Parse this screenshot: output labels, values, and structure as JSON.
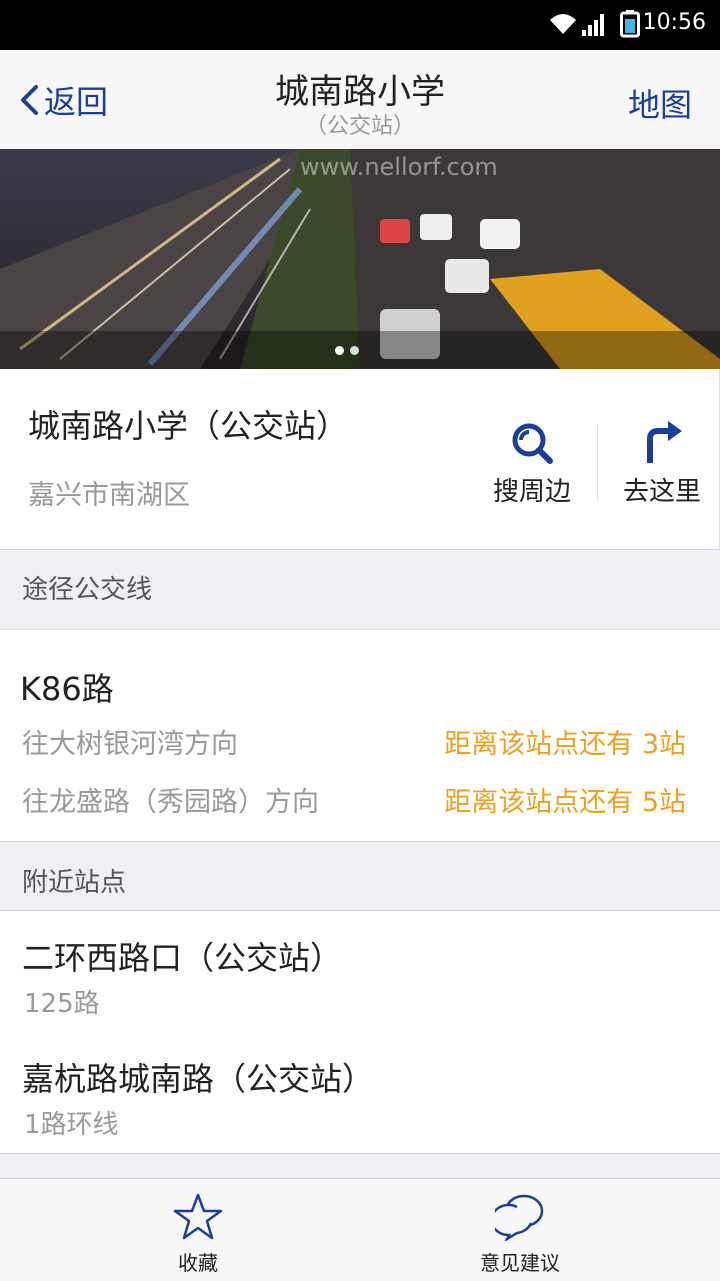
{
  "status_bar": {
    "time": "10:56",
    "icons": [
      "wifi-icon",
      "signal-icon",
      "battery-icon"
    ]
  },
  "nav": {
    "back_label": "返回",
    "title": "城南路小学",
    "subtitle": "（公交站）",
    "map_label": "地图",
    "accent_color": "#1a3e9a"
  },
  "banner": {
    "watermark": "www.nellorf.com",
    "page_count": 2,
    "active_page": 1
  },
  "place": {
    "name": "城南路小学（公交站）",
    "area": "嘉兴市南湖区",
    "actions": [
      {
        "label": "搜周边",
        "icon": "search-nearby-icon"
      },
      {
        "label": "去这里",
        "icon": "turn-right-icon"
      }
    ]
  },
  "lines_section": {
    "header": "途径公交线",
    "lines": [
      {
        "name": "K86路",
        "directions": [
          {
            "to": "往大树银河湾方向",
            "distance": "距离该站点还有 3站"
          },
          {
            "to": "往龙盛路（秀园路）方向",
            "distance": "距离该站点还有 5站"
          }
        ]
      }
    ],
    "distance_color": "#f0a020"
  },
  "nearby_section": {
    "header": "附近站点",
    "stops": [
      {
        "name": "二环西路口（公交站）",
        "lines": "125路"
      },
      {
        "name": "嘉杭路城南路（公交站）",
        "lines": "1路环线"
      }
    ]
  },
  "toolbar": {
    "favorite_label": "收藏",
    "feedback_label": "意见建议"
  }
}
